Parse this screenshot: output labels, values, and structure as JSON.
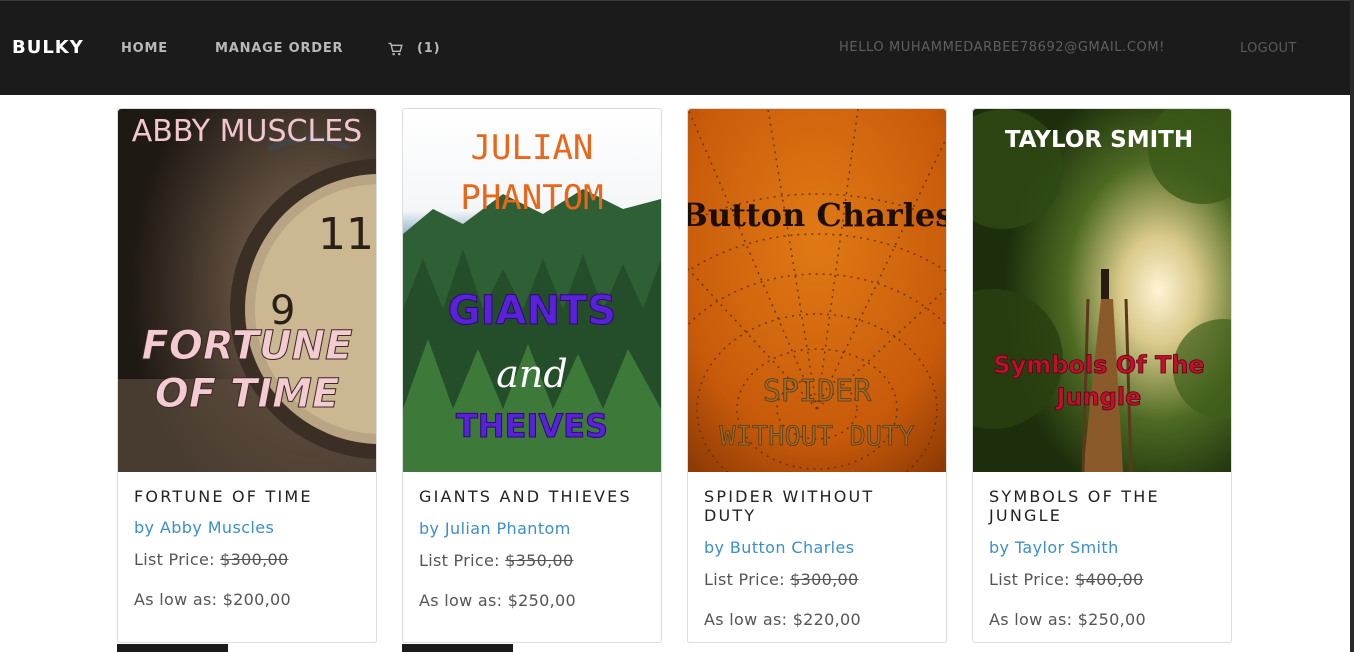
{
  "navbar": {
    "brand": "BULKY",
    "home": "HOME",
    "manage_order": "MANAGE ORDER",
    "cart_count": "(1)",
    "hello": "HELLO MUHAMMEDARBEE78692@GMAIL.COM!",
    "logout": "LOGOUT"
  },
  "products": [
    {
      "title": "FORTUNE OF TIME",
      "author": "by Abby Muscles",
      "list_label": "List Price:",
      "list_price": "$300,00",
      "low_label": "As low as:",
      "low_price": "$200,00",
      "cover_author": "ABBY MUSCLES",
      "cover_title_1": "FORTUNE",
      "cover_title_2": "OF TIME"
    },
    {
      "title": "GIANTS AND THIEVES",
      "author": "by Julian Phantom",
      "list_label": "List Price:",
      "list_price": "$350,00",
      "low_label": "As low as:",
      "low_price": "$250,00",
      "cover_author_1": "JULIAN",
      "cover_author_2": "PHANTOM",
      "cover_title_1": "GIANTS",
      "cover_title_2": "and",
      "cover_title_3": "THEIVES"
    },
    {
      "title": "SPIDER WITHOUT DUTY",
      "author": "by Button Charles",
      "list_label": "List Price:",
      "list_price": "$300,00",
      "low_label": "As low as:",
      "low_price": "$220,00",
      "cover_author": "Button Charles",
      "cover_title_1": "SPIDER",
      "cover_title_2": "WITHOUT DUTY"
    },
    {
      "title": "SYMBOLS OF THE JUNGLE",
      "author": "by Taylor Smith",
      "list_label": "List Price:",
      "list_price": "$400,00",
      "low_label": "As low as:",
      "low_price": "$250,00",
      "cover_author": "TAYLOR SMITH",
      "cover_title_1": "Symbols Of The",
      "cover_title_2": "Jungle"
    }
  ],
  "colors": {
    "navbar_bg": "#1b1b1b",
    "author_link": "#3b8fcb",
    "text": "#555555"
  },
  "icons": {
    "cart": "cart-icon"
  }
}
